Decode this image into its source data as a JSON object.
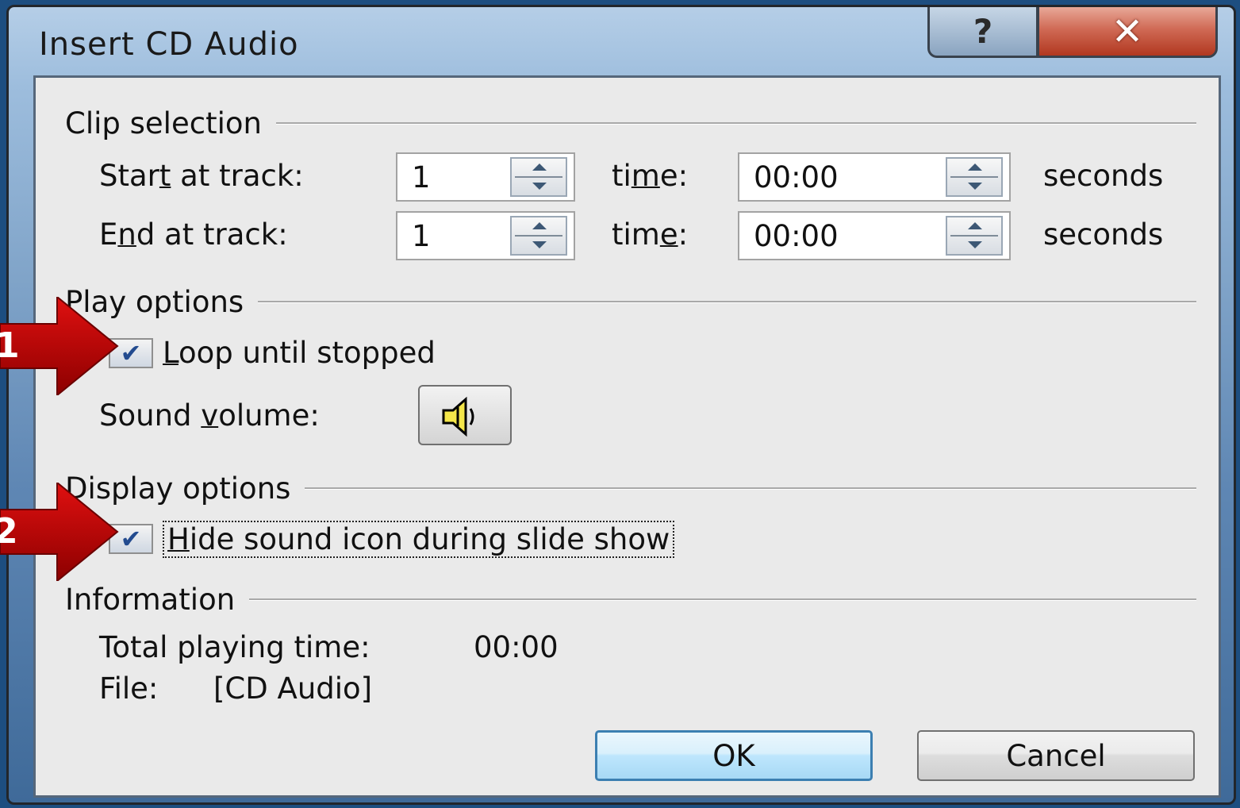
{
  "dialog": {
    "title": "Insert CD Audio",
    "help_button": "?",
    "close_button": "✕"
  },
  "clip_selection": {
    "group_label": "Clip selection",
    "start_label": "Start at track:",
    "start_track": "1",
    "start_time_label": "time:",
    "start_time": "00:00",
    "start_unit": "seconds",
    "end_label": "End at track:",
    "end_track": "1",
    "end_time_label": "time:",
    "end_time": "00:00",
    "end_unit": "seconds"
  },
  "play_options": {
    "group_label": "Play options",
    "loop_label": "Loop until stopped",
    "loop_checked": true,
    "volume_label": "Sound volume:",
    "volume_icon": "speaker-icon"
  },
  "display_options": {
    "group_label": "Display options",
    "hide_icon_label": "Hide sound icon during slide show",
    "hide_icon_checked": true
  },
  "information": {
    "group_label": "Information",
    "total_time_label": "Total playing time:",
    "total_time": "00:00",
    "file_label": "File:",
    "file_value": "[CD Audio]"
  },
  "buttons": {
    "ok": "OK",
    "cancel": "Cancel"
  },
  "annotations": [
    {
      "number": "1",
      "color": "#c00000"
    },
    {
      "number": "2",
      "color": "#c00000"
    }
  ]
}
